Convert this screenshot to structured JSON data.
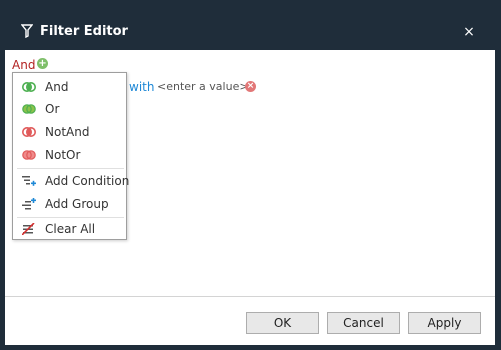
{
  "window": {
    "title": "Filter Editor",
    "close_label": "×"
  },
  "editor": {
    "root_operator": "And",
    "add_symbol": "+",
    "condition": {
      "operator": "with",
      "value_placeholder": "<enter a value>",
      "remove_symbol": "×"
    }
  },
  "menu": {
    "items": [
      {
        "label": "And",
        "icon": "and-icon"
      },
      {
        "label": "Or",
        "icon": "or-icon"
      },
      {
        "label": "NotAnd",
        "icon": "not-and-icon"
      },
      {
        "label": "NotOr",
        "icon": "not-or-icon"
      },
      {
        "label": "Add Condition",
        "icon": "add-condition-icon"
      },
      {
        "label": "Add Group",
        "icon": "add-group-icon"
      },
      {
        "label": "Clear All",
        "icon": "clear-all-icon"
      }
    ]
  },
  "footer": {
    "ok_label": "OK",
    "cancel_label": "Cancel",
    "apply_label": "Apply"
  },
  "colors": {
    "titlebar": "#1f2d3a",
    "root_operator": "#b22222",
    "condition_operator": "#1e88d6",
    "accent_green": "#7fbf6a",
    "accent_red": "#e27777"
  }
}
